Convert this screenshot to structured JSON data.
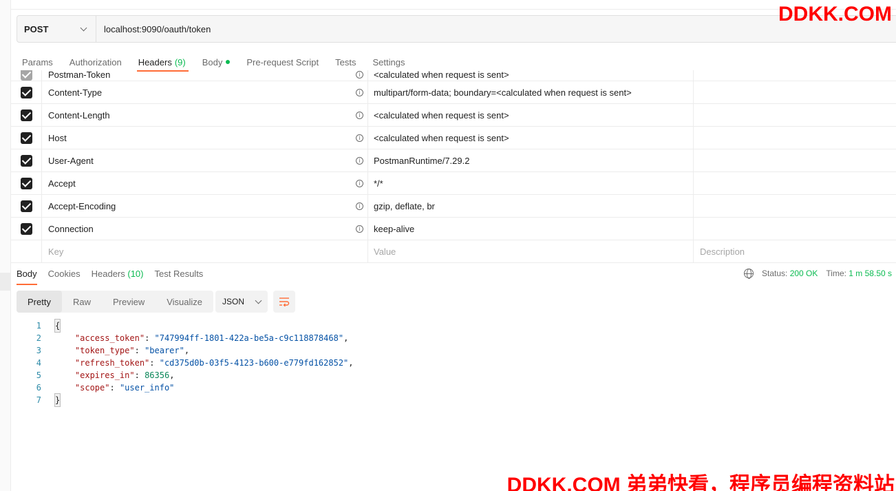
{
  "request": {
    "method": "POST",
    "url": "localhost:9090/oauth/token"
  },
  "request_tabs": [
    {
      "label": "Params"
    },
    {
      "label": "Authorization"
    },
    {
      "label": "Headers",
      "count": "(9)"
    },
    {
      "label": "Body"
    },
    {
      "label": "Pre-request Script"
    },
    {
      "label": "Tests"
    },
    {
      "label": "Settings"
    }
  ],
  "headers": {
    "partial_row": {
      "key": "Postman-Token",
      "value": "<calculated when request is sent>"
    },
    "rows": [
      {
        "key": "Content-Type",
        "value": "multipart/form-data; boundary=<calculated when request is sent>"
      },
      {
        "key": "Content-Length",
        "value": "<calculated when request is sent>"
      },
      {
        "key": "Host",
        "value": "<calculated when request is sent>"
      },
      {
        "key": "User-Agent",
        "value": "PostmanRuntime/7.29.2"
      },
      {
        "key": "Accept",
        "value": "*/*"
      },
      {
        "key": "Accept-Encoding",
        "value": "gzip, deflate, br"
      },
      {
        "key": "Connection",
        "value": "keep-alive"
      }
    ],
    "placeholders": {
      "key": "Key",
      "value": "Value",
      "description": "Description"
    }
  },
  "response_tabs": [
    {
      "label": "Body"
    },
    {
      "label": "Cookies"
    },
    {
      "label": "Headers",
      "count": "(10)"
    },
    {
      "label": "Test Results"
    }
  ],
  "response_status": {
    "status_label": "Status:",
    "status_value": "200 OK",
    "time_label": "Time:",
    "time_value": "1 m 58.50 s"
  },
  "format": {
    "buttons": [
      "Pretty",
      "Raw",
      "Preview",
      "Visualize"
    ],
    "language": "JSON"
  },
  "code": {
    "line_numbers": [
      "1",
      "2",
      "3",
      "4",
      "5",
      "6",
      "7"
    ],
    "open_brace": "{",
    "close_brace": "}",
    "entries": [
      {
        "key": "\"access_token\"",
        "value": "\"747994ff-1801-422a-be5a-c9c118878468\"",
        "comma": ","
      },
      {
        "key": "\"token_type\"",
        "value": "\"bearer\"",
        "comma": ","
      },
      {
        "key": "\"refresh_token\"",
        "value": "\"cd375d0b-03f5-4123-b600-e779fd162852\"",
        "comma": ","
      },
      {
        "key": "\"expires_in\"",
        "value": "86356",
        "comma": ","
      },
      {
        "key": "\"scope\"",
        "value": "\"user_info\"",
        "comma": ""
      }
    ]
  },
  "watermarks": {
    "top": "DDKK.COM",
    "bottom": "DDKK.COM 弟弟快看，程序员编程资料站"
  },
  "colors": {
    "accent": "#ff6c37",
    "success": "#0cbb52",
    "watermark": "#ff0000"
  }
}
